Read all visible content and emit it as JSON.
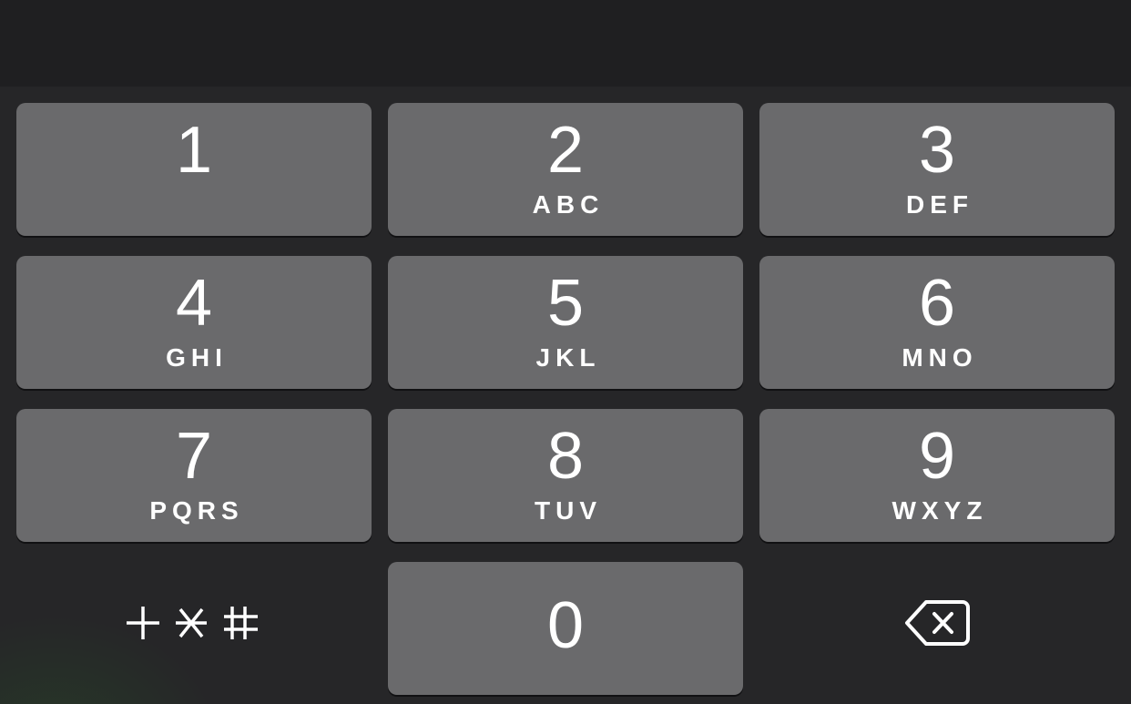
{
  "keypad": {
    "keys": [
      {
        "digit": "1",
        "letters": ""
      },
      {
        "digit": "2",
        "letters": "ABC"
      },
      {
        "digit": "3",
        "letters": "DEF"
      },
      {
        "digit": "4",
        "letters": "GHI"
      },
      {
        "digit": "5",
        "letters": "JKL"
      },
      {
        "digit": "6",
        "letters": "MNO"
      },
      {
        "digit": "7",
        "letters": "PQRS"
      },
      {
        "digit": "8",
        "letters": "TUV"
      },
      {
        "digit": "9",
        "letters": "WXYZ"
      },
      {
        "digit": "0",
        "letters": ""
      }
    ],
    "symbols_key": {
      "icon": "plus-asterisk-hash-icon"
    },
    "delete_key": {
      "icon": "backspace-icon"
    }
  },
  "colors": {
    "background": "#262628",
    "top_bar": "#1f1f21",
    "key": "#6a6a6c",
    "text": "#ffffff"
  }
}
